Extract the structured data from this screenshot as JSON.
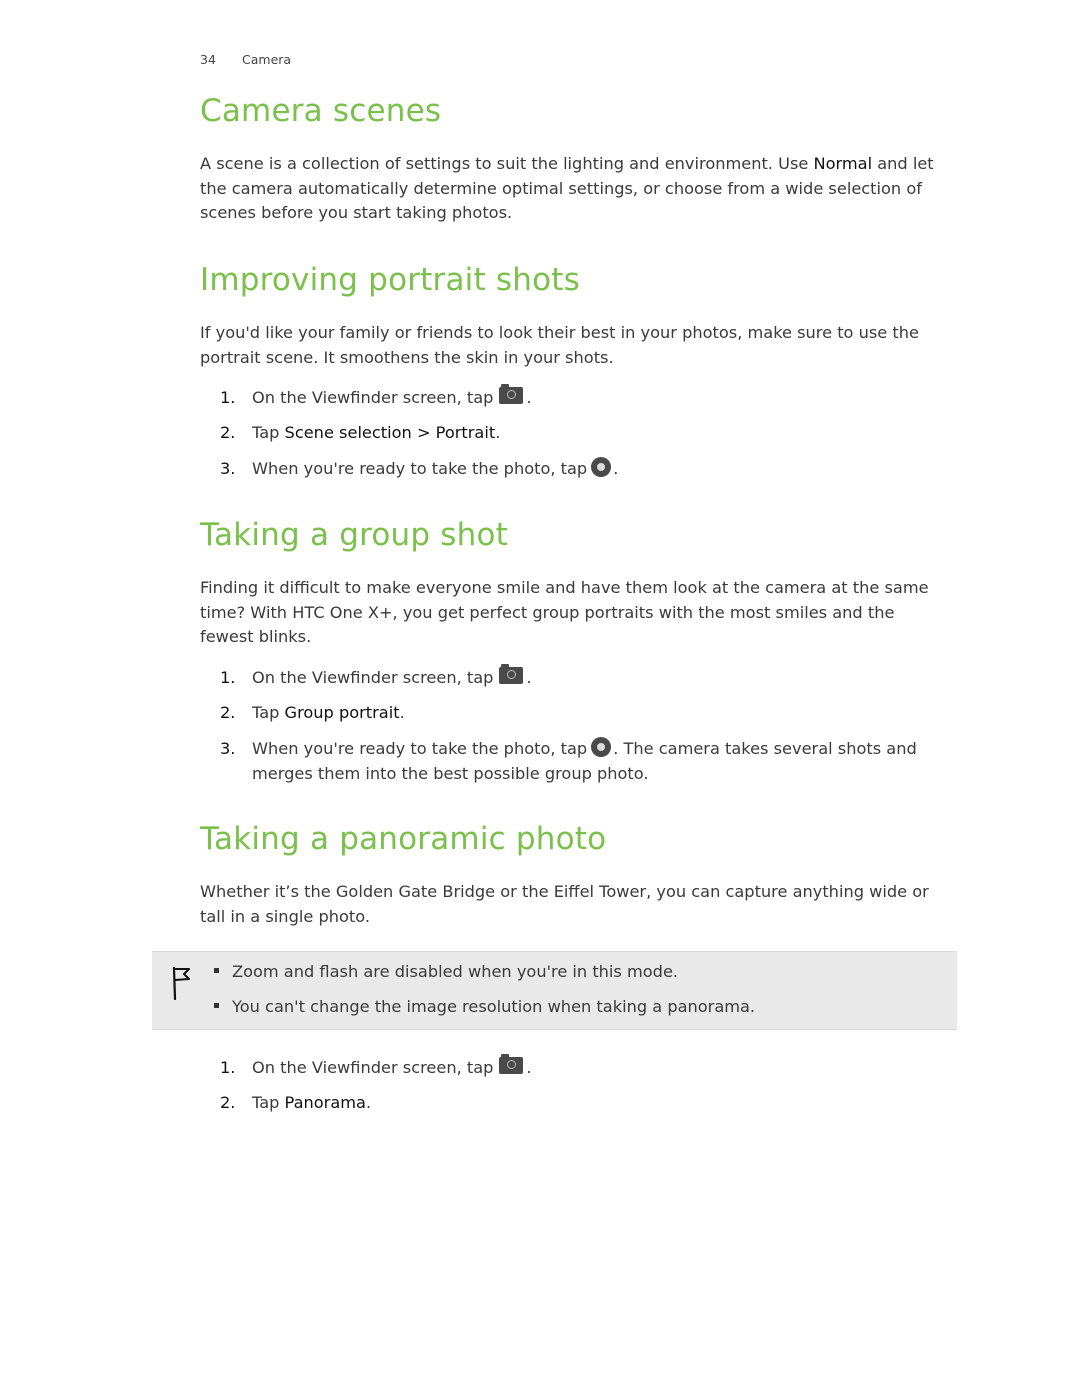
{
  "header": {
    "page_number": "34",
    "chapter": "Camera"
  },
  "sections": {
    "camera_scenes": {
      "title": "Camera scenes",
      "para_before": "A scene is a collection of settings to suit the lighting and environment. Use ",
      "para_em": "Normal",
      "para_after": " and let the camera automatically determine optimal settings, or choose from a wide selection of scenes before you start taking photos."
    },
    "portrait": {
      "title": "Improving portrait shots",
      "para": "If you'd like your family or friends to look their best in your photos, make sure to use the portrait scene. It smoothens the skin in your shots.",
      "steps": [
        {
          "num": "1.",
          "text": "On the Viewfinder screen, tap",
          "icon": "camera-settings-icon",
          "after": "."
        },
        {
          "num": "2.",
          "text": "Tap ",
          "em1": "Scene selection",
          "sep": " > ",
          "em2": "Portrait",
          "after": "."
        },
        {
          "num": "3.",
          "text": "When you're ready to take the photo, tap",
          "icon": "shutter-icon",
          "after": "."
        }
      ]
    },
    "group": {
      "title": "Taking a group shot",
      "para": "Finding it difficult to make everyone smile and have them look at the camera at the same time? With HTC One X+, you get perfect group portraits with the most smiles and the fewest blinks.",
      "steps": [
        {
          "num": "1.",
          "text": "On the Viewfinder screen, tap",
          "icon": "camera-settings-icon",
          "after": "."
        },
        {
          "num": "2.",
          "text": "Tap ",
          "em": "Group portrait",
          "after": "."
        },
        {
          "num": "3.",
          "text": "When you're ready to take the photo, tap",
          "icon": "shutter-icon",
          "after": ". The camera takes several shots and merges them into the best possible group photo."
        }
      ]
    },
    "panoramic": {
      "title": "Taking a panoramic photo",
      "para": "Whether it’s the Golden Gate Bridge or the Eiffel Tower, you can capture anything wide or tall in a single photo.",
      "note_icon": "flag-icon",
      "notes": [
        "Zoom and flash are disabled when you're in this mode.",
        "You can't change the image resolution when taking a panorama."
      ],
      "steps": [
        {
          "num": "1.",
          "text": "On the Viewfinder screen, tap",
          "icon": "camera-settings-icon",
          "after": "."
        },
        {
          "num": "2.",
          "text": "Tap ",
          "em": "Panorama",
          "after": "."
        }
      ]
    }
  }
}
